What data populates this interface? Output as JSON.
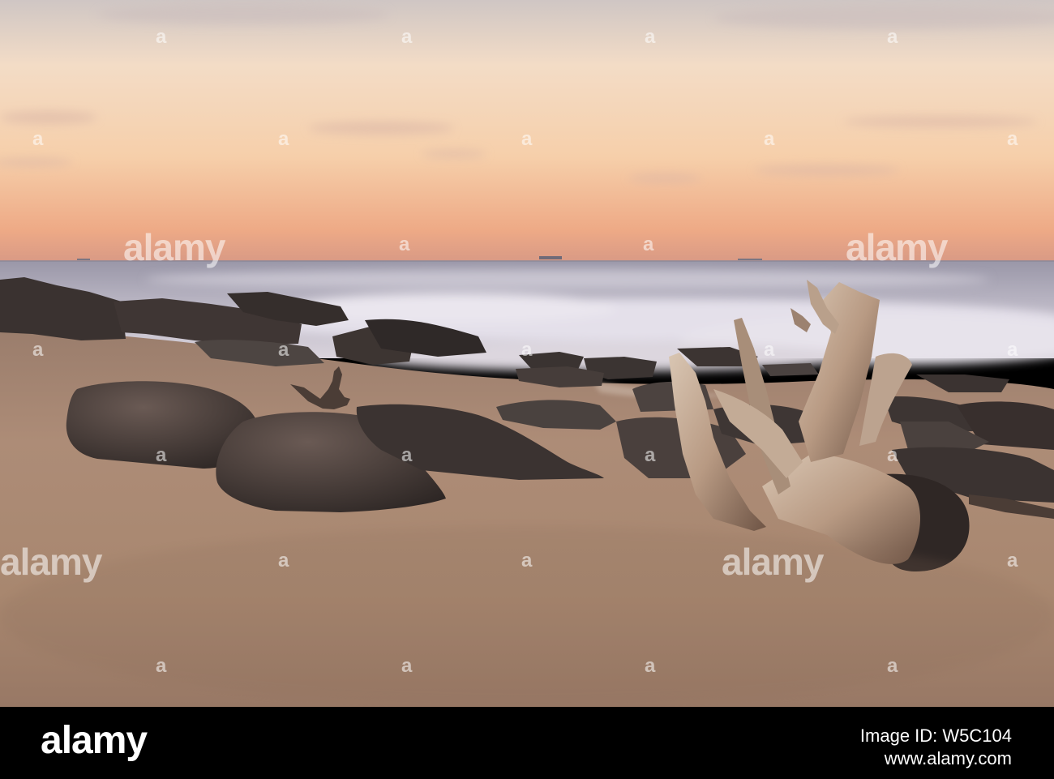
{
  "photo": {
    "watermark_text": "alamy",
    "colors": {
      "sky_top": "#cfc3c2",
      "sky_glow": "#f4cda8",
      "horizon": "#e9a583",
      "sea": "#8f8da0",
      "surf": "#e6e2ea",
      "sand": "#a98a76",
      "sand_dark": "#836655",
      "rock": "#3c3432",
      "driftwood": "#c9b29d"
    }
  },
  "footer": {
    "brand": "alamy",
    "image_id_line": "Image ID: W5C104",
    "site_line": "www.alamy.com"
  }
}
